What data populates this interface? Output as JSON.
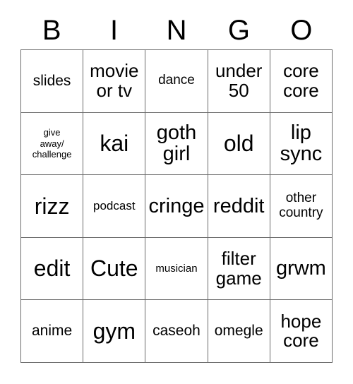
{
  "card": {
    "title": "BINGO",
    "header_letters": [
      "B",
      "I",
      "N",
      "G",
      "O"
    ],
    "columns": 5,
    "rows": 5,
    "colors": {
      "background": "#ffffff",
      "text": "#000000",
      "grid_line": "#6b6b6b"
    },
    "cells": [
      [
        {
          "text": "slides",
          "size": "fs-l"
        },
        {
          "text": "movie\nor tv",
          "size": "fs-xl"
        },
        {
          "text": "dance",
          "size": "fs-ml"
        },
        {
          "text": "under\n50",
          "size": "fs-xl"
        },
        {
          "text": "core\ncore",
          "size": "fs-xl"
        }
      ],
      [
        {
          "text": "give\naway/\nchallenge",
          "size": "fs-xs"
        },
        {
          "text": "kai",
          "size": "fs-huge"
        },
        {
          "text": "goth\ngirl",
          "size": "fs-xxl"
        },
        {
          "text": "old",
          "size": "fs-huge"
        },
        {
          "text": "lip\nsync",
          "size": "fs-xxl"
        }
      ],
      [
        {
          "text": "rizz",
          "size": "fs-huge"
        },
        {
          "text": "podcast",
          "size": "fs-m"
        },
        {
          "text": "cringe",
          "size": "fs-xxl"
        },
        {
          "text": "reddit",
          "size": "fs-xxl"
        },
        {
          "text": "other\ncountry",
          "size": "fs-ml"
        }
      ],
      [
        {
          "text": "edit",
          "size": "fs-huge"
        },
        {
          "text": "Cute",
          "size": "fs-huge"
        },
        {
          "text": "musician",
          "size": "fs-s"
        },
        {
          "text": "filter\ngame",
          "size": "fs-xl"
        },
        {
          "text": "grwm",
          "size": "fs-xxl"
        }
      ],
      [
        {
          "text": "anime",
          "size": "fs-l"
        },
        {
          "text": "gym",
          "size": "fs-huge"
        },
        {
          "text": "caseoh",
          "size": "fs-l"
        },
        {
          "text": "omegle",
          "size": "fs-l"
        },
        {
          "text": "hope\ncore",
          "size": "fs-xl"
        }
      ]
    ]
  }
}
